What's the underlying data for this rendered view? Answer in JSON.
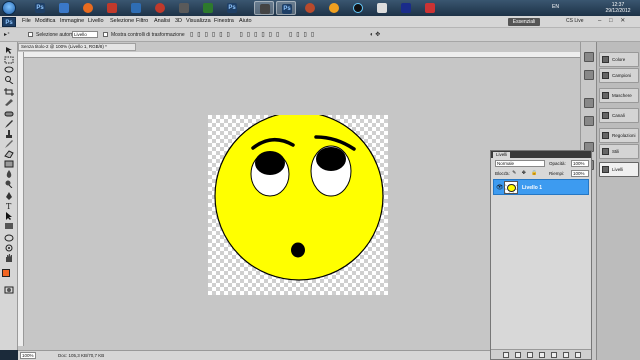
{
  "taskbar": {
    "apps": [
      {
        "name": "start-orb",
        "glyph": ""
      },
      {
        "name": "app-ps-cs3",
        "glyph": "Ps"
      },
      {
        "name": "app-firefox",
        "glyph": ""
      },
      {
        "name": "app-ps",
        "glyph": "Ps"
      },
      {
        "name": "app-ps-active",
        "glyph": "Ps"
      }
    ],
    "lang": "EN",
    "time": "12:37",
    "date": "29/12/2012"
  },
  "menubar": {
    "app_logo": "Ps",
    "items": [
      "File",
      "Modifica",
      "Immagine",
      "Livello",
      "Selezione",
      "Filtro",
      "Analisi",
      "3D",
      "Visualizza",
      "Finestra",
      "Aiuto"
    ],
    "workspace_button": "Essenziali",
    "cs_live": "CS Live",
    "window_controls": "– □ ✕"
  },
  "options_bar": {
    "auto_select_label": "Selezione automatica:",
    "auto_select_value": "Livello",
    "show_transform_label": "Mostra controlli di trasformazione"
  },
  "document": {
    "tab_title": "Senza titolo-2 @ 100% (Livello 1, RGB/8) *"
  },
  "statusbar": {
    "zoom": "100%",
    "doc_info": "Doc: 105,3 KB/70,7 KB"
  },
  "panels": {
    "items": [
      {
        "label": "Colore"
      },
      {
        "label": "Campioni"
      },
      {
        "label": "Maschere"
      },
      {
        "label": "Canali"
      },
      {
        "label": "Regolazioni"
      },
      {
        "label": "Stili"
      },
      {
        "label": "Livelli"
      }
    ]
  },
  "layers_panel": {
    "tab": "Livelli",
    "blend_mode": "Normale",
    "opacity_label": "Opacità:",
    "opacity_value": "100%",
    "lock_label": "Blocca:",
    "fill_label": "Riempi:",
    "fill_value": "100%",
    "layers": [
      {
        "name": "Livello 1",
        "visible": true,
        "selected": true
      }
    ]
  },
  "colors": {
    "foreground": "#f26522",
    "layer_selected": "#3d9bf0",
    "smiley": "#ffff00"
  }
}
